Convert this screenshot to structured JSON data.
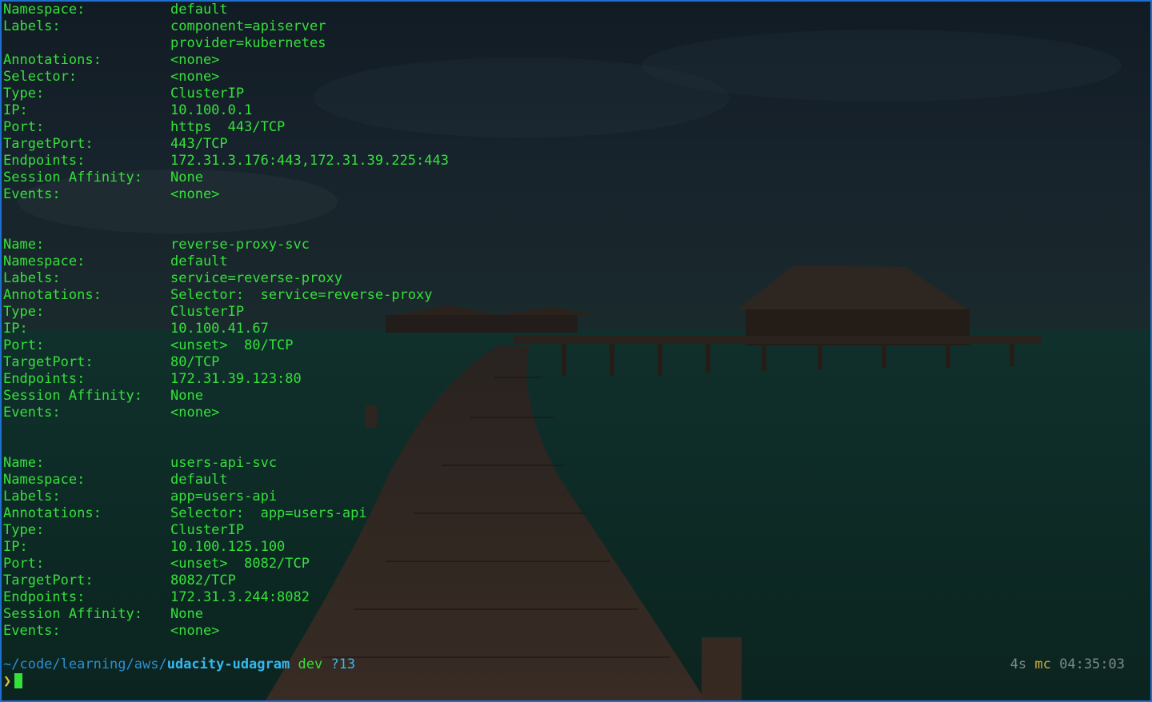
{
  "blocks": [
    {
      "rows": [
        {
          "key": "Namespace:",
          "value": "default"
        },
        {
          "key": "Labels:",
          "value": "component=apiserver"
        },
        {
          "key": "",
          "value": "provider=kubernetes"
        },
        {
          "key": "Annotations:",
          "value": "<none>"
        },
        {
          "key": "Selector:",
          "value": "<none>"
        },
        {
          "key": "Type:",
          "value": "ClusterIP"
        },
        {
          "key": "IP:",
          "value": "10.100.0.1"
        },
        {
          "key": "Port:",
          "value": "https  443/TCP"
        },
        {
          "key": "TargetPort:",
          "value": "443/TCP"
        },
        {
          "key": "Endpoints:",
          "value": "172.31.3.176:443,172.31.39.225:443"
        },
        {
          "key": "Session Affinity:",
          "value": "None"
        },
        {
          "key": "Events:",
          "value": "<none>"
        }
      ]
    },
    {
      "rows": [
        {
          "key": "Name:",
          "value": "reverse-proxy-svc"
        },
        {
          "key": "Namespace:",
          "value": "default"
        },
        {
          "key": "Labels:",
          "value": "service=reverse-proxy"
        },
        {
          "key": "Annotations:",
          "value": "Selector:  service=reverse-proxy"
        },
        {
          "key": "Type:",
          "value": "ClusterIP"
        },
        {
          "key": "IP:",
          "value": "10.100.41.67"
        },
        {
          "key": "Port:",
          "value": "<unset>  80/TCP"
        },
        {
          "key": "TargetPort:",
          "value": "80/TCP"
        },
        {
          "key": "Endpoints:",
          "value": "172.31.39.123:80"
        },
        {
          "key": "Session Affinity:",
          "value": "None"
        },
        {
          "key": "Events:",
          "value": "<none>"
        }
      ]
    },
    {
      "rows": [
        {
          "key": "Name:",
          "value": "users-api-svc"
        },
        {
          "key": "Namespace:",
          "value": "default"
        },
        {
          "key": "Labels:",
          "value": "app=users-api"
        },
        {
          "key": "Annotations:",
          "value": "Selector:  app=users-api"
        },
        {
          "key": "Type:",
          "value": "ClusterIP"
        },
        {
          "key": "IP:",
          "value": "10.100.125.100"
        },
        {
          "key": "Port:",
          "value": "<unset>  8082/TCP"
        },
        {
          "key": "TargetPort:",
          "value": "8082/TCP"
        },
        {
          "key": "Endpoints:",
          "value": "172.31.3.244:8082"
        },
        {
          "key": "Session Affinity:",
          "value": "None"
        },
        {
          "key": "Events:",
          "value": "<none>"
        }
      ]
    }
  ],
  "prompt": {
    "path_prefix": "~/code/learning/aws/",
    "path_dir": "udacity-udagram",
    "branch": "dev",
    "untracked": "?13",
    "duration": "4s",
    "host": "mc",
    "time": "04:35:03",
    "symbol": "❯"
  },
  "colors": {
    "output_text": "#35e03a",
    "path": "#2a8fd6",
    "path_bold": "#35b8f0",
    "host": "#c9b03a",
    "prompt_symbol": "#e0c23a",
    "border": "#1e6fd0"
  }
}
